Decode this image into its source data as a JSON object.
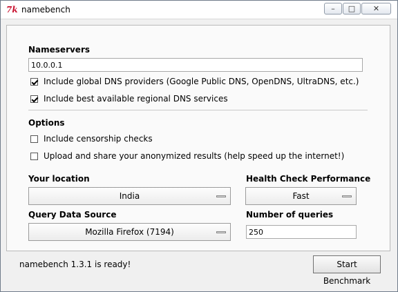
{
  "window": {
    "title": "namebench",
    "icon_glyph": "7k",
    "controls": {
      "minimize": "–",
      "maximize": "□",
      "close": "✕"
    }
  },
  "nameservers": {
    "heading": "Nameservers",
    "input_value": "10.0.0.1",
    "include_global": {
      "label": "Include global DNS providers (Google Public DNS, OpenDNS, UltraDNS, etc.)",
      "checked": true
    },
    "include_regional": {
      "label": "Include best available regional DNS services",
      "checked": true
    }
  },
  "options": {
    "heading": "Options",
    "censorship": {
      "label": "Include censorship checks",
      "checked": false
    },
    "upload": {
      "label": "Upload and share your anonymized results (help speed up the internet!)",
      "checked": false
    }
  },
  "location": {
    "heading": "Your location",
    "selected": "India"
  },
  "health_check": {
    "heading": "Health Check Performance",
    "selected": "Fast"
  },
  "query_source": {
    "heading": "Query Data Source",
    "selected": "Mozilla Firefox (7194)"
  },
  "num_queries": {
    "heading": "Number of queries",
    "value": "250"
  },
  "status": {
    "text": "namebench 1.3.1 is ready!"
  },
  "actions": {
    "start_label": "Start Benchmark"
  }
}
